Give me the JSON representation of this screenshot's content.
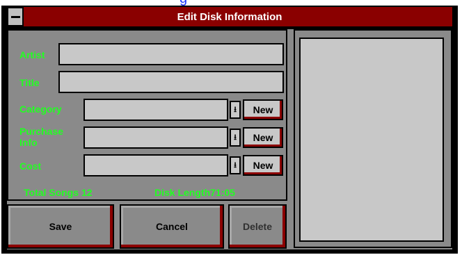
{
  "window": {
    "title": "Edit Disk Information"
  },
  "form": {
    "artist_label": "Artist",
    "artist_value": "",
    "title_label": "Title",
    "title_value": "",
    "category_label": "Category",
    "category_value": "",
    "purchase_label_line1": "Purchase",
    "purchase_label_line2": "Info",
    "purchase_value": "",
    "cost_label": "Cost",
    "cost_value": "",
    "new_label": "New"
  },
  "stats": {
    "total_songs_label": "Total Songs",
    "total_songs_value": "12",
    "disk_length_label": "Disk Length",
    "disk_length_value": "71:05"
  },
  "buttons": {
    "save": "Save",
    "cancel": "Cancel",
    "delete": "Delete"
  },
  "colors": {
    "titlebar": "#8a0000",
    "label_green": "#22ff22",
    "panel_gray": "#8a8a8a",
    "field_gray": "#c8c8c8"
  }
}
